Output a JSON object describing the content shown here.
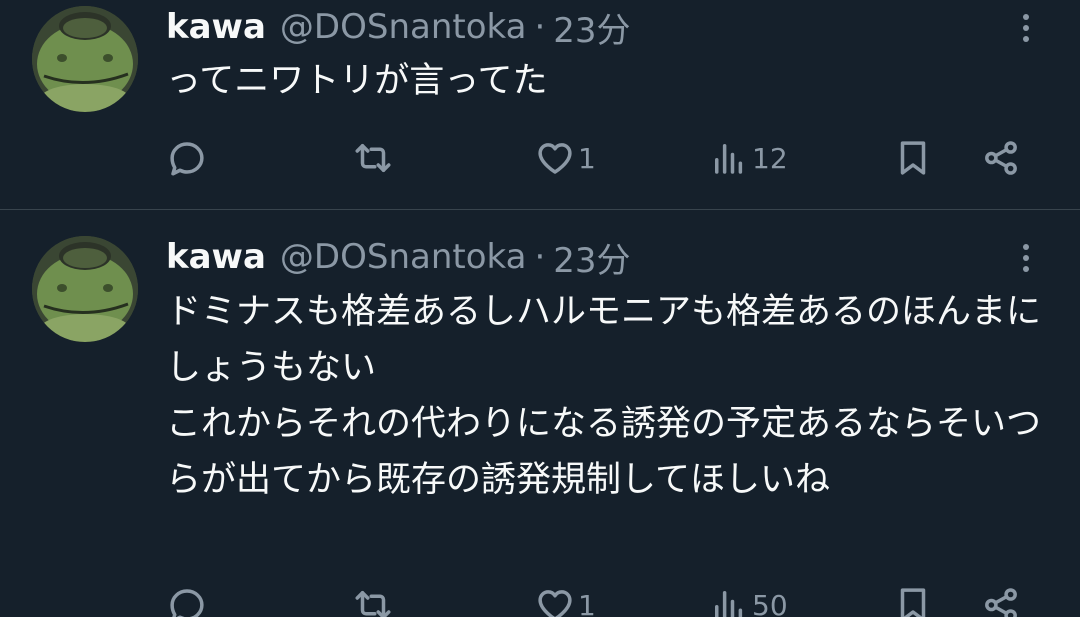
{
  "tweets": [
    {
      "display_name": "kawa",
      "handle": "@DOSnantoka",
      "separator": "·",
      "time": "23分",
      "text": "ってニワトリが言ってた",
      "likes": "1",
      "views": "12"
    },
    {
      "display_name": "kawa",
      "handle": "@DOSnantoka",
      "separator": "·",
      "time": "23分",
      "text": "ドミナスも格差あるしハルモニアも格差あるのほんまにしょうもない\nこれからそれの代わりになる誘発の予定あるならそいつらが出てから既存の誘発規制してほしいね",
      "likes": "1",
      "views": "50"
    }
  ],
  "icons": {
    "reply": "speech-bubble-icon",
    "retweet": "retweet-arrows-icon",
    "like": "heart-icon",
    "views": "bar-chart-icon",
    "bookmark": "bookmark-icon",
    "share": "share-nodes-icon",
    "more": "vertical-ellipsis-icon"
  },
  "colors": {
    "background": "#15202b",
    "primary_text": "#f7f9f9",
    "secondary_text": "#8b98a5",
    "divider": "#38444d"
  }
}
